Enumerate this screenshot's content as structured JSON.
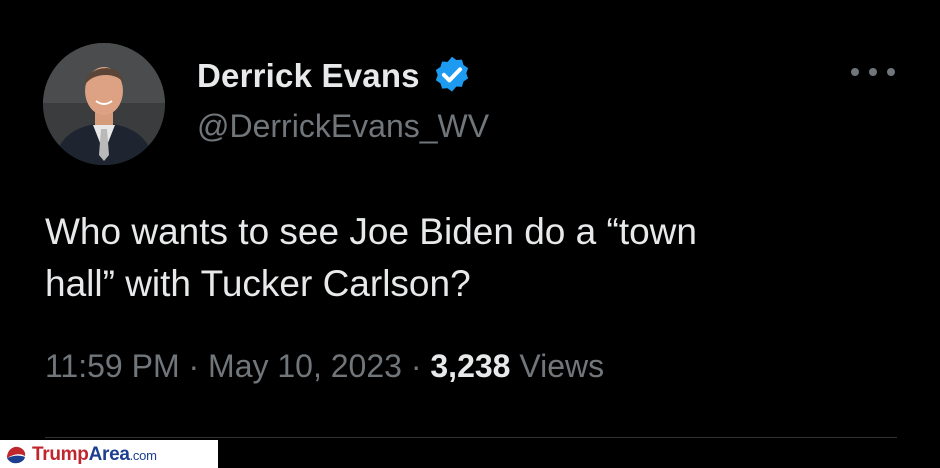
{
  "author": {
    "display_name": "Derrick Evans",
    "handle": "@DerrickEvans_WV",
    "avatar_icon": "profile-photo-icon",
    "verified_icon": "verified-badge-icon",
    "verified_color": "#1d9bf0"
  },
  "tweet": {
    "text_line1": "Who wants to see Joe Biden do a “town",
    "text_line2": "hall” with Tucker Carlson?",
    "time": "11:59 PM",
    "date": "May 10, 2023",
    "separator": "·",
    "views_count": "3,238",
    "views_label": "Views"
  },
  "menu": {
    "icon": "more-options-icon"
  },
  "watermark": {
    "brand_part1": "Trump",
    "brand_part2": "Area",
    "domain": ".com",
    "icon": "trumparea-logo-icon"
  },
  "colors": {
    "background": "#000000",
    "primary_text": "#e7e9ea",
    "secondary_text": "#71767b",
    "accent": "#1d9bf0"
  }
}
